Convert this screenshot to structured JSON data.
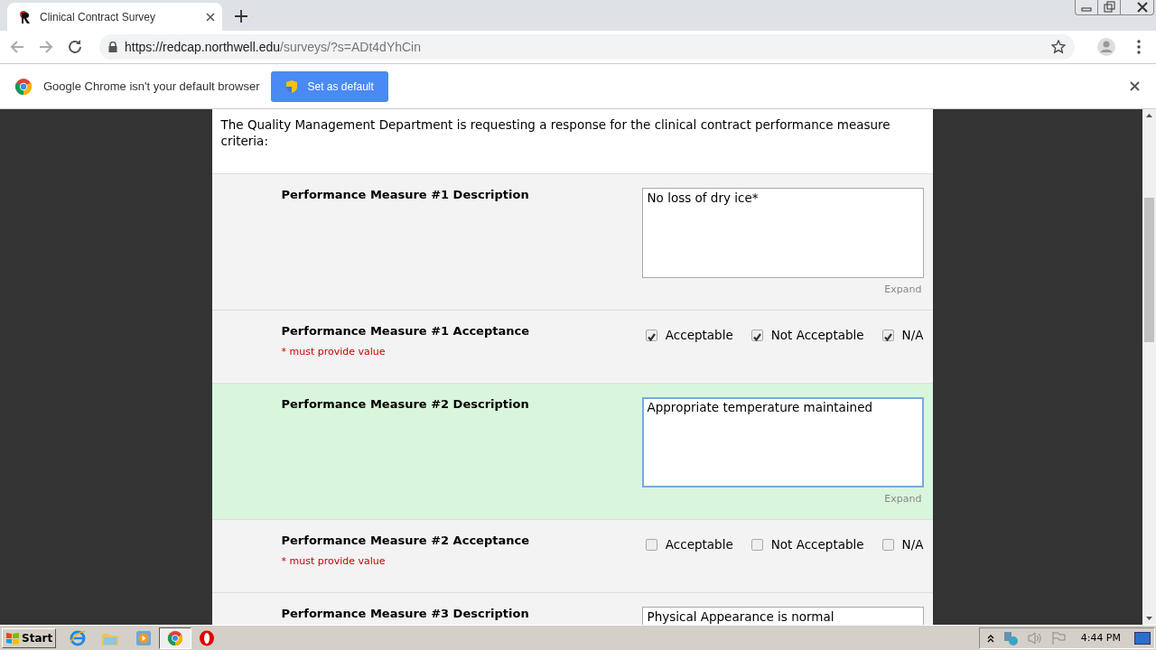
{
  "browser": {
    "tab": {
      "title": "Clinical Contract Survey"
    },
    "url": {
      "host": "https://redcap.northwell.edu",
      "path": "/surveys/?s=ADt4dYhCin"
    },
    "infobar": {
      "message": "Google Chrome isn't your default browser",
      "button": "Set as default"
    }
  },
  "survey": {
    "intro": "The Quality Management Department is requesting a response for the clinical contract performance measure criteria:",
    "fields": [
      {
        "kind": "text",
        "label": "Performance Measure #1 Description",
        "value": "No loss of dry ice*",
        "expand": "Expand",
        "highlighted": false
      },
      {
        "kind": "checkboxes",
        "label": "Performance Measure #1 Acceptance",
        "required": "* must provide value",
        "highlighted": false,
        "options": [
          {
            "label": "Acceptable",
            "checked": true
          },
          {
            "label": "Not Acceptable",
            "checked": true
          },
          {
            "label": "N/A",
            "checked": true
          }
        ]
      },
      {
        "kind": "text",
        "label": "Performance Measure #2 Description",
        "value": "Appropriate temperature maintained",
        "expand": "Expand",
        "highlighted": true
      },
      {
        "kind": "checkboxes",
        "label": "Performance Measure #2 Acceptance",
        "required": "* must provide value",
        "highlighted": false,
        "options": [
          {
            "label": "Acceptable",
            "checked": false
          },
          {
            "label": "Not Acceptable",
            "checked": false
          },
          {
            "label": "N/A",
            "checked": false
          }
        ]
      },
      {
        "kind": "text",
        "label": "Performance Measure #3 Description",
        "value": "Physical Appearance is normal",
        "highlighted": false
      }
    ]
  },
  "taskbar": {
    "start": "Start",
    "clock": "4:44 PM"
  }
}
